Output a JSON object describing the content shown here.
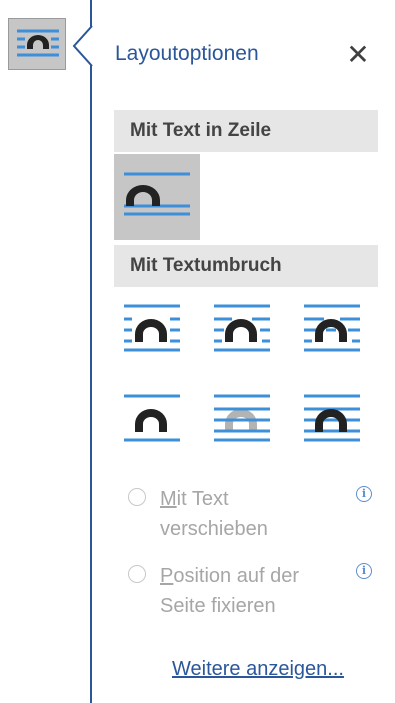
{
  "pane": {
    "title": "Layoutoptionen",
    "close_glyph": "✕",
    "accent_color": "#2b579a"
  },
  "sections": {
    "inline": {
      "header": "Mit Text in Zeile"
    },
    "wrap": {
      "header": "Mit Textumbruch"
    }
  },
  "options": {
    "inline": {
      "icon": "inline-with-text-icon",
      "selected": true
    },
    "square": {
      "icon": "wrap-square-icon"
    },
    "tight": {
      "icon": "wrap-tight-icon"
    },
    "through": {
      "icon": "wrap-through-icon"
    },
    "top_bottom": {
      "icon": "wrap-top-bottom-icon"
    },
    "behind_text": {
      "icon": "behind-text-icon"
    },
    "in_front": {
      "icon": "in-front-of-text-icon"
    }
  },
  "radios": {
    "move_with_text": {
      "first": "M",
      "rest": "it Text",
      "line2": "verschieben",
      "enabled": false
    },
    "fix_position": {
      "first": "P",
      "rest": "osition auf der",
      "line2": "Seite fixieren",
      "enabled": false
    }
  },
  "info_glyph": "i",
  "more_link": "Weitere anzeigen..."
}
